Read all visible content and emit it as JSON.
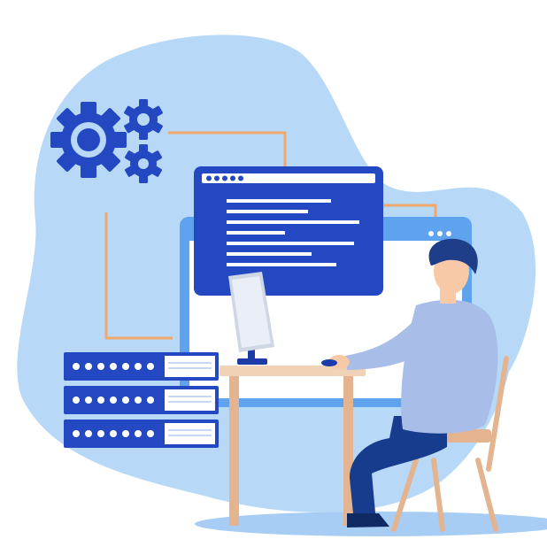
{
  "palette": {
    "blob": "#b7d9f7",
    "primary": "#2448c2",
    "primary_dark": "#1c3aa8",
    "monitor_frame": "#5fa2ee",
    "connector": "#f2a86a",
    "desk": "#f1d2b6",
    "desk_edge": "#e3b48f",
    "shirt": "#a9bde9",
    "pants": "#173c8e",
    "hair": "#1f3e8a",
    "skin": "#f7c9a6",
    "floor_shadow": "#a7cdf4"
  },
  "icons": {
    "gears": "gears-icon",
    "server": "server-rack-icon",
    "code_window": "code-window-icon",
    "monitor": "monitor-icon"
  }
}
